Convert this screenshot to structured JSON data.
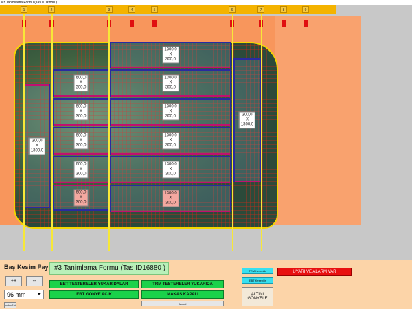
{
  "window": {
    "title": "#3 Tanimlama Formu (Tas ID16880 )"
  },
  "ruler": {
    "ticks": [
      "1",
      "2",
      "3",
      "4",
      "5",
      "6",
      "7",
      "8",
      "9"
    ]
  },
  "pieces": {
    "left": {
      "w": "300,0",
      "x": "X",
      "h": "1300,0"
    },
    "right": {
      "w": "300,0",
      "x": "X",
      "h": "1300,0"
    },
    "small": [
      {
        "w": "600,0",
        "x": "X",
        "h": "300,0"
      },
      {
        "w": "600,0",
        "x": "X",
        "h": "300,0"
      },
      {
        "w": "600,0",
        "x": "X",
        "h": "300,0"
      },
      {
        "w": "600,0",
        "x": "X",
        "h": "300,0"
      },
      {
        "w": "600,0",
        "x": "X",
        "h": "300,0"
      }
    ],
    "large": [
      {
        "w": "1300,0",
        "x": "X",
        "h": "300,0"
      },
      {
        "w": "1300,0",
        "x": "X",
        "h": "300,0"
      },
      {
        "w": "1300,0",
        "x": "X",
        "h": "300,0"
      },
      {
        "w": "1300,0",
        "x": "X",
        "h": "300,0"
      },
      {
        "w": "1300,0",
        "x": "X",
        "h": "300,0"
      },
      {
        "w": "1300,0",
        "x": "X",
        "h": "300,0"
      }
    ]
  },
  "bottom": {
    "bas_kesim_label": "Baş Kesim Payi",
    "plus_button": "++",
    "minus_button": "--",
    "mm_value": "96 mm",
    "small_button": "bulbin1%",
    "form_title": "#3 Tanimlama Formu (Tas ID16880 )",
    "ebt_testereler": "EBT TESTERELER YUKARIDALAR",
    "trm_testereler": "TRM TESTERELER YUKARIDA",
    "ebt_gonye": "EBT GONYE ACIK",
    "makas": "MAKAS KAPALI",
    "small_gray": "fankol",
    "trm_kesilabilir": "TRM Kesebilir",
    "ebt_kesilabilir": "EBT Kesebilir",
    "altini_gonyele": "ALTINI GÖNYELE",
    "uyari": "UYARI VE ALARM VAR"
  }
}
